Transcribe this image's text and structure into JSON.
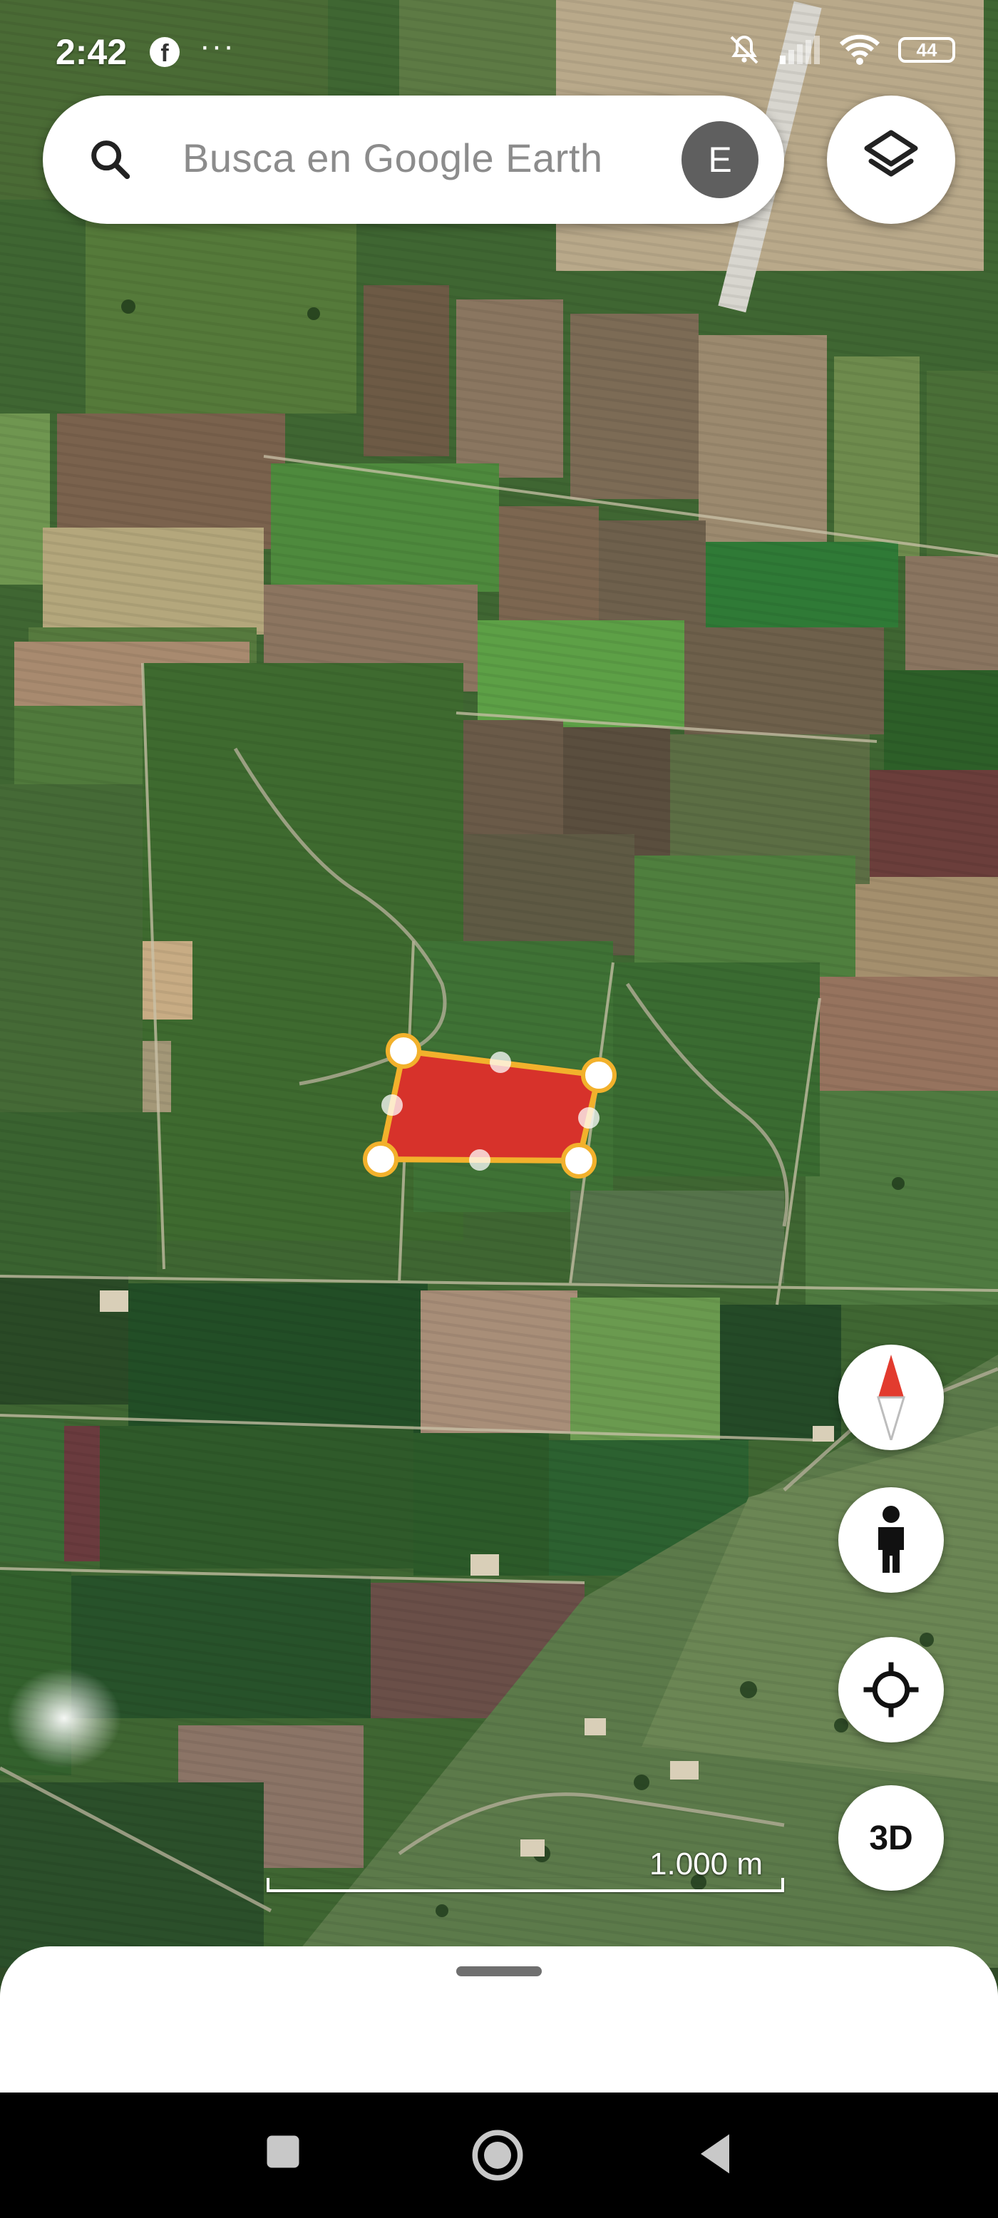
{
  "status_bar": {
    "time": "2:42",
    "notification_more": "···",
    "battery_level": "44",
    "icons": [
      "facebook-icon",
      "more-notifications-icon",
      "muted-notifications-icon",
      "signal-icon",
      "wifi-icon",
      "battery-icon"
    ]
  },
  "search": {
    "placeholder": "Busca en Google Earth",
    "avatar_letter": "E",
    "icon": "search-icon"
  },
  "map": {
    "type": "satellite",
    "polygon": {
      "fill": "#d7322b",
      "stroke": "#f2b12c",
      "vertices": 4,
      "midpoints": 4
    }
  },
  "controls": {
    "layers": "layers-icon",
    "compass": "compass-icon",
    "street_view": "pegman-icon",
    "my_location": "my-location-icon",
    "mode_3d_label": "3D"
  },
  "scale": {
    "label": "1.000 m"
  },
  "nav": [
    "recents-icon",
    "home-icon",
    "back-icon"
  ],
  "colors": {
    "polygon_fill": "#d7322b",
    "polygon_stroke": "#f2b12c",
    "compass_red": "#e23b2e"
  }
}
